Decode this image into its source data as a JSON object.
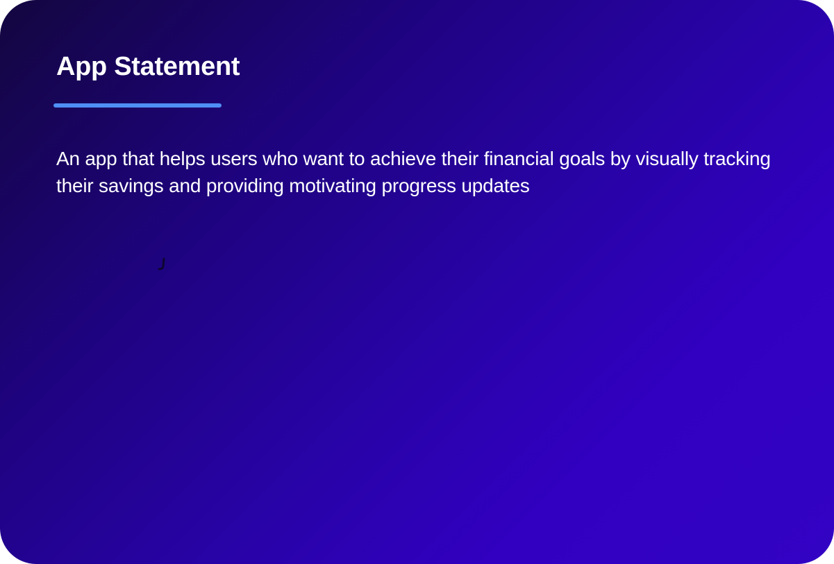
{
  "card": {
    "title": "App Statement",
    "statement": "An app that helps users who want to achieve their financial goals by visually tracking their savings and providing motivating progress updates"
  },
  "colors": {
    "gradient_start": "#13063f",
    "gradient_end": "#3303c4",
    "accent_underline": "#4f8ff5",
    "text": "#ffffff"
  },
  "icons": {
    "cursor": "text-cursor-mark"
  }
}
